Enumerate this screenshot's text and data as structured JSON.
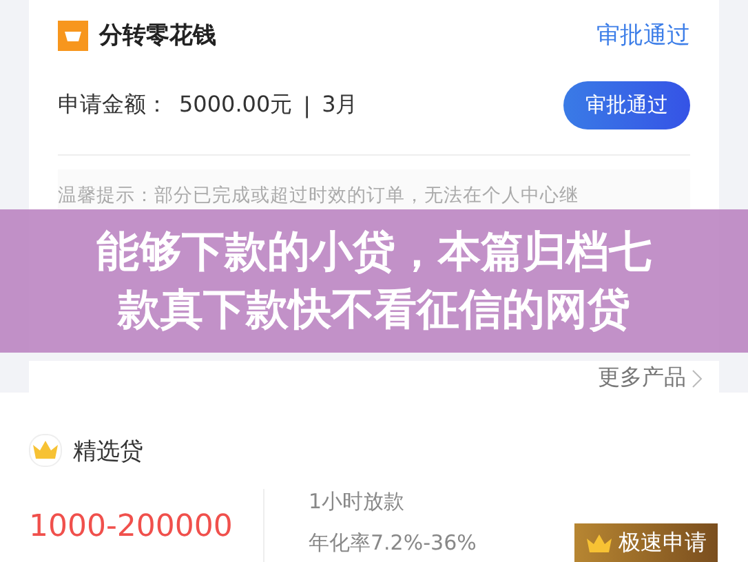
{
  "order_card": {
    "title": "分转零花钱",
    "status": "审批通过",
    "amount_label": "申请金额：",
    "amount": "5000.00元",
    "separator": "|",
    "term": "3月",
    "button": "审批通过",
    "notice": "温馨提示：部分已完成或超过时效的订单，无法在个人中心继"
  },
  "banner": {
    "title": "能够下款的小贷，本篇归档七款真下款快不看征信的网贷"
  },
  "more_link": {
    "label": "更多产品"
  },
  "product_card": {
    "title": "精选贷",
    "amount_range": "1000-200000",
    "feature": "1小时放款",
    "rate": "年化率7.2%-36%",
    "button": "极速申请"
  }
}
